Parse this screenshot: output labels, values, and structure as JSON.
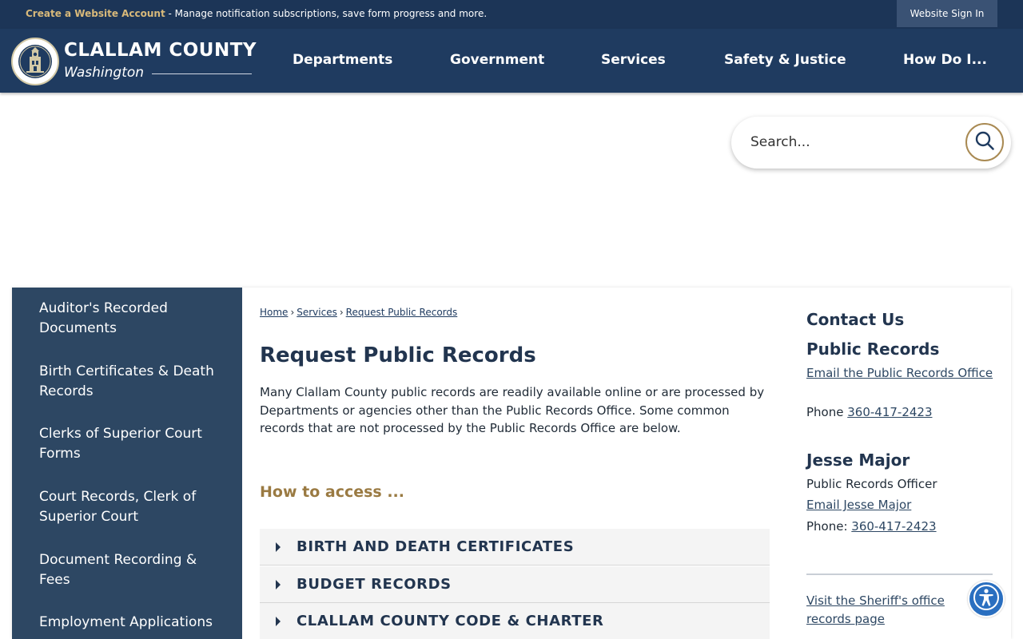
{
  "topbar": {
    "create_link": "Create a Website Account",
    "notice_text": " - Manage notification subscriptions, save form progress and more.",
    "signin_label": "Website Sign In"
  },
  "header": {
    "logo_title": "CLALLAM COUNTY",
    "logo_subtitle": "Washington",
    "nav": [
      "Departments",
      "Government",
      "Services",
      "Safety & Justice",
      "How Do I..."
    ]
  },
  "search": {
    "placeholder": "Search..."
  },
  "sidebar": {
    "items": [
      {
        "label": "Auditor's Recorded Documents"
      },
      {
        "label": "Birth Certificates & Death Records"
      },
      {
        "label": "Clerks of Superior Court Forms"
      },
      {
        "label": "Court Records, Clerk of Superior Court"
      },
      {
        "label": "Document Recording & Fees"
      },
      {
        "label": "Employment Applications"
      }
    ]
  },
  "breadcrumb": {
    "items": [
      "Home",
      "Services",
      "Request Public Records"
    ],
    "separator": "›"
  },
  "main": {
    "title": "Request Public Records",
    "intro": "Many Clallam County public records are readily available online or are processed by Departments or agencies other than the Public Records Office. Some common records that are not processed by the Public Records Office are below.",
    "how_to_heading": "How to access ...",
    "accordions": [
      {
        "label": "BIRTH AND DEATH CERTIFICATES"
      },
      {
        "label": "BUDGET RECORDS"
      },
      {
        "label": "CLALLAM COUNTY CODE & CHARTER"
      }
    ]
  },
  "contact": {
    "heading": "Contact Us",
    "office_heading": "Public Records",
    "office_email_link": "Email the Public Records Office",
    "phone_label": "Phone ",
    "phone": "360-417-2423",
    "person_name": "Jesse Major",
    "person_title": "Public Records Officer",
    "person_email_link": "Email Jesse Major",
    "person_phone_label": "Phone: ",
    "person_phone": "360-417-2423",
    "sheriff_link": "Visit the Sheriff's office records page"
  },
  "colors": {
    "header_bg": "#1f3b60",
    "topbar_bg": "#1c3557",
    "sidebar_bg": "#2d4763",
    "accent_gold": "#9a7a42",
    "accessibility_blue": "#2a6fc0"
  },
  "icons": {
    "search": "search-icon",
    "accordion": "caret-right-icon",
    "accessibility": "accessibility-icon",
    "logo": "county-seal-icon"
  }
}
